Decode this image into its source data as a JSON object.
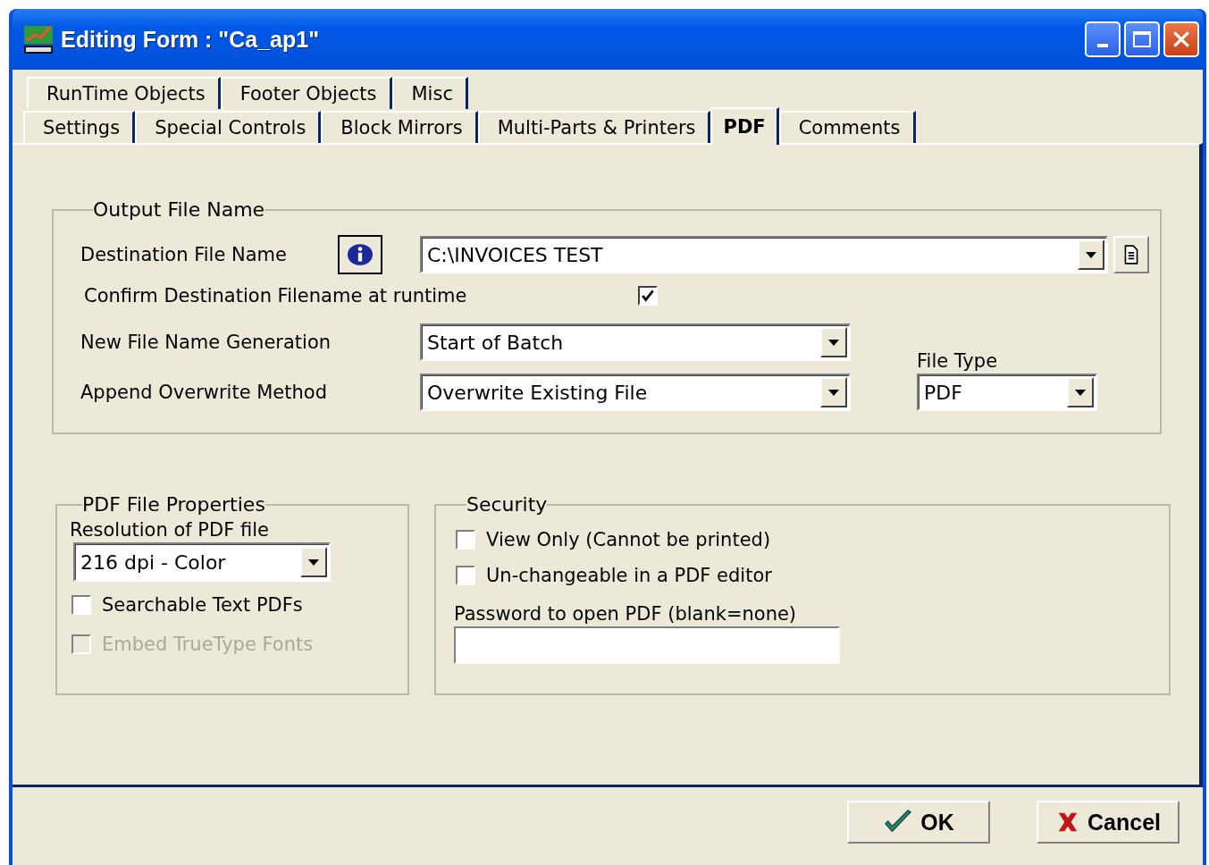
{
  "window": {
    "title": "Editing Form : \"Ca_ap1\""
  },
  "tab_rows": [
    {
      "tabs": [
        {
          "label": "RunTime Objects",
          "selected": false
        },
        {
          "label": "Footer Objects",
          "selected": false
        },
        {
          "label": "Misc",
          "selected": false
        }
      ]
    },
    {
      "tabs": [
        {
          "label": "Settings",
          "selected": false
        },
        {
          "label": "Special Controls",
          "selected": false
        },
        {
          "label": "Block Mirrors",
          "selected": false
        },
        {
          "label": "Multi-Parts & Printers",
          "selected": false
        },
        {
          "label": "PDF",
          "selected": true
        },
        {
          "label": "Comments",
          "selected": false
        }
      ]
    }
  ],
  "output_file_name": {
    "legend": "Output File Name",
    "destination": {
      "label": "Destination File Name",
      "value": "C:\\INVOICES TEST"
    },
    "confirm": {
      "label": "Confirm Destination Filename at runtime",
      "checked": true
    },
    "generation": {
      "label": "New File Name Generation",
      "value": "Start of Batch"
    },
    "append": {
      "label": "Append Overwrite Method",
      "value": "Overwrite Existing File"
    },
    "file_type": {
      "label": "File Type",
      "value": "PDF"
    }
  },
  "pdf_file_properties": {
    "legend": "PDF File Properties",
    "resolution": {
      "label": "Resolution of PDF file",
      "value": "216 dpi - Color"
    },
    "options": [
      {
        "label": "Searchable Text PDFs",
        "checked": false,
        "disabled": false
      },
      {
        "label": "Embed TrueType Fonts",
        "checked": false,
        "disabled": true
      }
    ]
  },
  "security": {
    "legend": "Security",
    "options": [
      {
        "label": "View Only (Cannot be printed)",
        "checked": false
      },
      {
        "label": "Un-changeable in a PDF editor",
        "checked": false
      }
    ],
    "password": {
      "label": "Password to open PDF (blank=none)"
    }
  },
  "buttons": [
    {
      "label": "OK",
      "kind": "ok"
    },
    {
      "label": "Cancel",
      "kind": "cancel"
    }
  ]
}
